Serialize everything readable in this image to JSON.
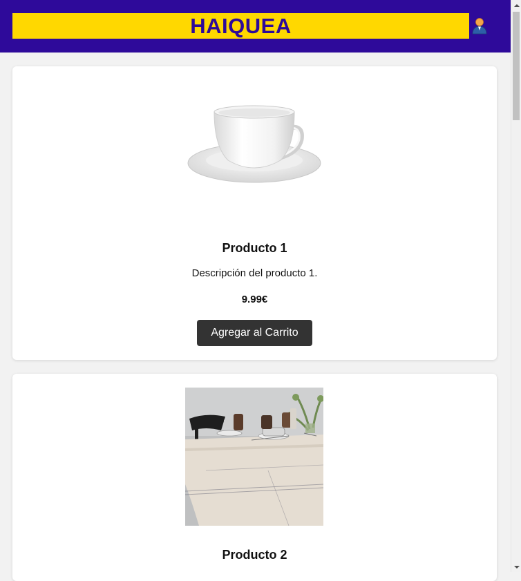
{
  "header": {
    "logo_text": "HAIQUEA",
    "user_icon": "user-account-icon"
  },
  "products": [
    {
      "title": "Producto 1",
      "description": "Descripción del producto 1.",
      "price": "9.99€",
      "button_label": "Agregar al Carrito",
      "image_icon": "teacup-saucer-image"
    },
    {
      "title": "Producto 2",
      "image_icon": "dining-table-tablecloth-image"
    }
  ],
  "colors": {
    "header_bg": "#2e0a9a",
    "logo_bg": "#ffd800",
    "button_bg": "#333333"
  }
}
